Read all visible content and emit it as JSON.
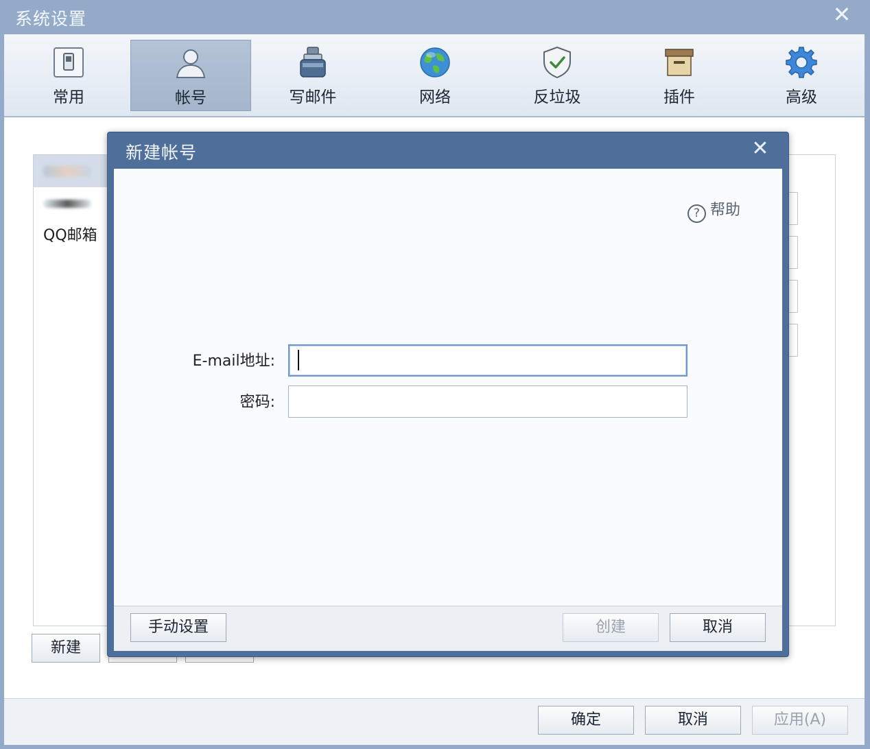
{
  "window": {
    "title": "系统设置"
  },
  "toolbar": {
    "items": [
      {
        "label": "常用",
        "icon": "switch-icon"
      },
      {
        "label": "帐号",
        "icon": "user-icon"
      },
      {
        "label": "写邮件",
        "icon": "ink-bottle-icon"
      },
      {
        "label": "网络",
        "icon": "globe-icon"
      },
      {
        "label": "反垃圾",
        "icon": "shield-check-icon"
      },
      {
        "label": "插件",
        "icon": "archive-box-icon"
      },
      {
        "label": "高级",
        "icon": "gear-icon"
      }
    ],
    "active_index": 1
  },
  "accounts": {
    "items": [
      {
        "label": ""
      },
      {
        "label": ""
      },
      {
        "label": "QQ邮箱"
      }
    ],
    "selected_index": 0,
    "new_button": "新建"
  },
  "dialog": {
    "title": "新建帐号",
    "help": "帮助",
    "email_label": "E-mail地址:",
    "email_value": "",
    "password_label": "密码:",
    "password_value": "",
    "manual_button": "手动设置",
    "create_button": "创建",
    "cancel_button": "取消"
  },
  "footer": {
    "ok_button": "确定",
    "cancel_button": "取消",
    "apply_button": "应用(A)"
  },
  "colors": {
    "title_bar": "#93abc9",
    "dialog_frame": "#4e6f99",
    "focus_border": "#6f97cc"
  }
}
